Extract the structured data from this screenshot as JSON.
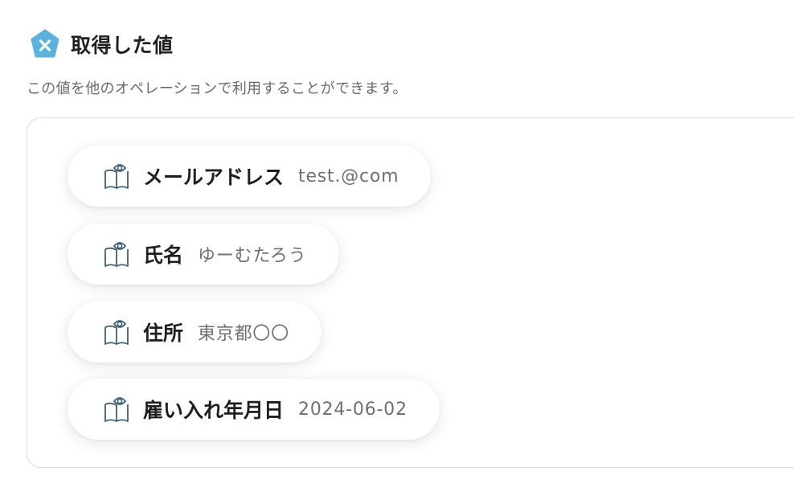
{
  "header": {
    "logo_icon": "yoom-pentagon-x-icon",
    "title": "取得した値",
    "accent": "#5bb2dd"
  },
  "description": "この値を他のオペレーションで利用することができます。",
  "fields": [
    {
      "label": "メールアドレス",
      "value": "test.@com",
      "icon": "book-eye-icon"
    },
    {
      "label": "氏名",
      "value": "ゆーむたろう",
      "icon": "book-eye-icon"
    },
    {
      "label": "住所",
      "value": "東京都〇〇",
      "icon": "book-eye-icon"
    },
    {
      "label": "雇い入れ年月日",
      "value": "2024-06-02",
      "icon": "book-eye-icon"
    }
  ]
}
